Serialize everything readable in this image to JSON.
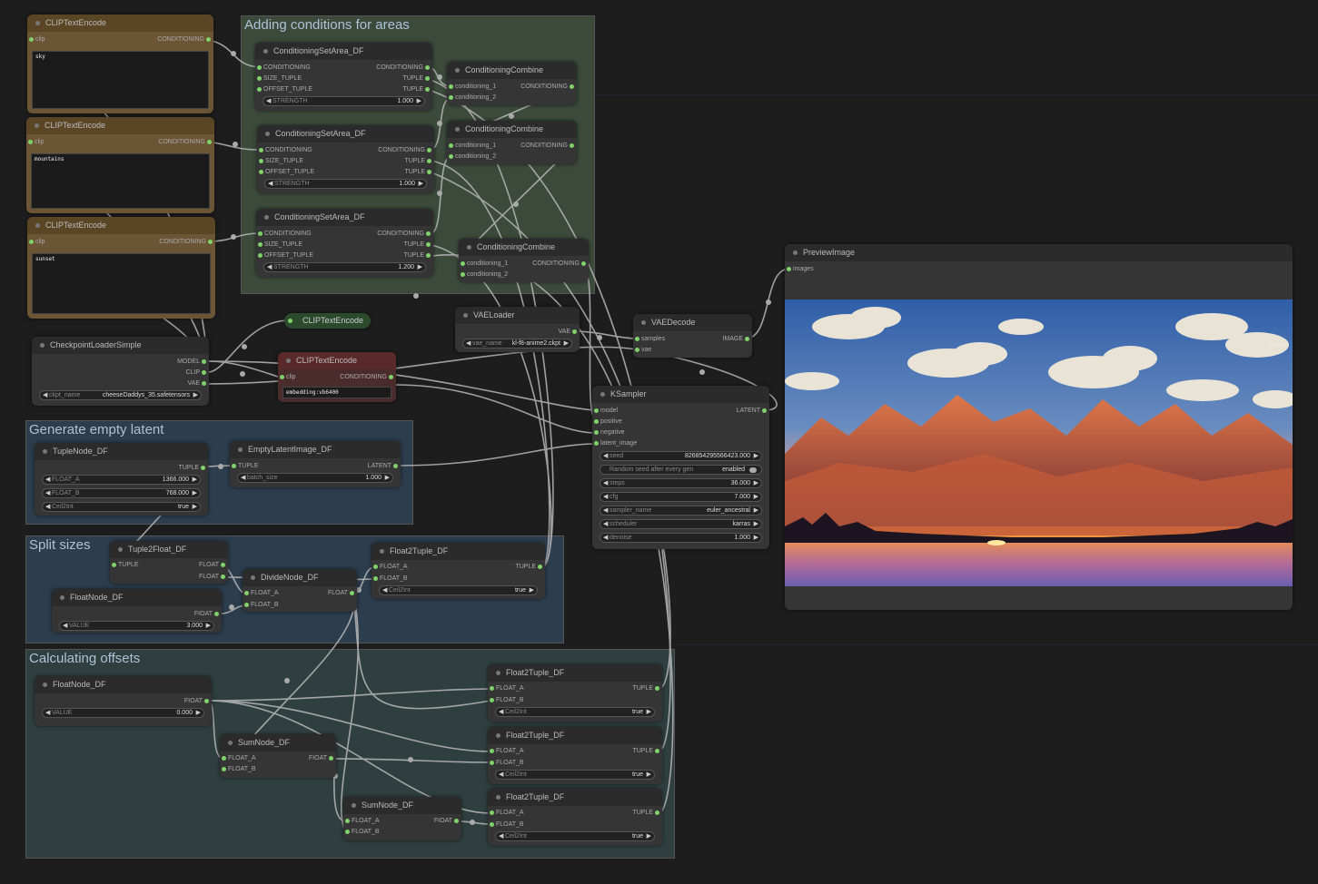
{
  "groups": {
    "adding_conditions": "Adding conditions for areas",
    "empty_latent": "Generate empty latent",
    "split_sizes": "Split sizes",
    "offsets": "Calculating offsets"
  },
  "clip1": {
    "title": "CLIPTextEncode",
    "in": "clip",
    "out": "CONDITIONING",
    "text": "sky"
  },
  "clip2": {
    "title": "CLIPTextEncode",
    "in": "clip",
    "out": "CONDITIONING",
    "text": "mountains"
  },
  "clip3": {
    "title": "CLIPTextEncode",
    "in": "clip",
    "out": "CONDITIONING",
    "text": "sunset"
  },
  "csa1": {
    "title": "ConditioningSetArea_DF",
    "i1": "CONDITIONING",
    "i2": "SIZE_TUPLE",
    "i3": "OFFSET_TUPLE",
    "o1": "CONDITIONING",
    "o2": "TUPLE",
    "o3": "TUPLE",
    "wl": "STRENGTH",
    "wv": "1.000"
  },
  "csa2": {
    "title": "ConditioningSetArea_DF",
    "i1": "CONDITIONING",
    "i2": "SIZE_TUPLE",
    "i3": "OFFSET_TUPLE",
    "o1": "CONDITIONING",
    "o2": "TUPLE",
    "o3": "TUPLE",
    "wl": "STRENGTH",
    "wv": "1.000"
  },
  "csa3": {
    "title": "ConditioningSetArea_DF",
    "i1": "CONDITIONING",
    "i2": "SIZE_TUPLE",
    "i3": "OFFSET_TUPLE",
    "o1": "CONDITIONING",
    "o2": "TUPLE",
    "o3": "TUPLE",
    "wl": "STRENGTH",
    "wv": "1.200"
  },
  "cc1": {
    "title": "ConditioningCombine",
    "i1": "conditioning_1",
    "i2": "conditioning_2",
    "o1": "CONDITIONING"
  },
  "cc2": {
    "title": "ConditioningCombine",
    "i1": "conditioning_1",
    "i2": "conditioning_2",
    "o1": "CONDITIONING"
  },
  "cc3": {
    "title": "ConditioningCombine",
    "i1": "conditioning_1",
    "i2": "conditioning_2",
    "o1": "CONDITIONING"
  },
  "ckpt": {
    "title": "CheckpointLoaderSimple",
    "o1": "MODEL",
    "o2": "CLIP",
    "o3": "VAE",
    "wl": "ckpt_name",
    "wv": "cheeseDaddys_35.safetensors"
  },
  "clipcollapsed": {
    "title": "CLIPTextEncode"
  },
  "clipneg": {
    "title": "CLIPTextEncode",
    "in": "clip",
    "out": "CONDITIONING",
    "text": "embedding:vb6400"
  },
  "vaeloader": {
    "title": "VAELoader",
    "o1": "VAE",
    "wl": "vae_name",
    "wv": "kl-f8-anime2.ckpt"
  },
  "vaedecode": {
    "title": "VAEDecode",
    "i1": "samples",
    "i2": "vae",
    "o1": "IMAGE"
  },
  "preview": {
    "title": "PreviewImage",
    "i1": "images"
  },
  "ksampler": {
    "title": "KSampler",
    "i1": "model",
    "i2": "positive",
    "i3": "negative",
    "i4": "latent_image",
    "o1": "LATENT",
    "seed_l": "seed",
    "seed_v": "826854295566423.000",
    "rand_l": "Random seed after every gen",
    "rand_v": "enabled",
    "steps_l": "steps",
    "steps_v": "36.000",
    "cfg_l": "cfg",
    "cfg_v": "7.000",
    "sampler_l": "sampler_name",
    "sampler_v": "euler_ancestral",
    "sched_l": "scheduler",
    "sched_v": "karras",
    "denoise_l": "denoise",
    "denoise_v": "1.000"
  },
  "tuplenode": {
    "title": "TupleNode_DF",
    "o1": "TUPLE",
    "w1l": "FLOAT_A",
    "w1v": "1366.000",
    "w2l": "FLOAT_B",
    "w2v": "768.000",
    "w3l": "Ceil2Int",
    "w3v": "true"
  },
  "emptylatent": {
    "title": "EmptyLatentImage_DF",
    "i1": "TUPLE",
    "o1": "LATENT",
    "wl": "batch_size",
    "wv": "1.000"
  },
  "tuple2float": {
    "title": "Tuple2Float_DF",
    "i1": "TUPLE",
    "o1": "FLOAT",
    "o2": "FLOAT"
  },
  "divide": {
    "title": "DivideNode_DF",
    "i1": "FLOAT_A",
    "i2": "FLOAT_B",
    "o1": "FLOAT"
  },
  "float2tuple_a": {
    "title": "Float2Tuple_DF",
    "i1": "FLOAT_A",
    "i2": "FLOAT_B",
    "o1": "TUPLE",
    "wl": "Ceil2Int",
    "wv": "true"
  },
  "floatnode1": {
    "title": "FloatNode_DF",
    "o1": "FIOAT",
    "wl": "VALUE",
    "wv": "3.000"
  },
  "floatnode2": {
    "title": "FloatNode_DF",
    "o1": "FIOAT",
    "wl": "VALUE",
    "wv": "0.000"
  },
  "sum1": {
    "title": "SumNode_DF",
    "i1": "FLOAT_A",
    "i2": "FLOAT_B",
    "o1": "FIOAT"
  },
  "sum2": {
    "title": "SumNode_DF",
    "i1": "FLOAT_A",
    "i2": "FLOAT_B",
    "o1": "FIOAT"
  },
  "f2t1": {
    "title": "Float2Tuple_DF",
    "i1": "FLOAT_A",
    "i2": "FLOAT_B",
    "o1": "TUPLE",
    "wl": "Ceil2Int",
    "wv": "true"
  },
  "f2t2": {
    "title": "Float2Tuple_DF",
    "i1": "FLOAT_A",
    "i2": "FLOAT_B",
    "o1": "TUPLE",
    "wl": "Ceil2Int",
    "wv": "true"
  },
  "f2t3": {
    "title": "Float2Tuple_DF",
    "i1": "FLOAT_A",
    "i2": "FLOAT_B",
    "o1": "TUPLE",
    "wl": "Ceil2Int",
    "wv": "true"
  },
  "colors": {
    "socket": "#7fd36a",
    "canvas": "#1d1d1d",
    "node": "#353535"
  }
}
